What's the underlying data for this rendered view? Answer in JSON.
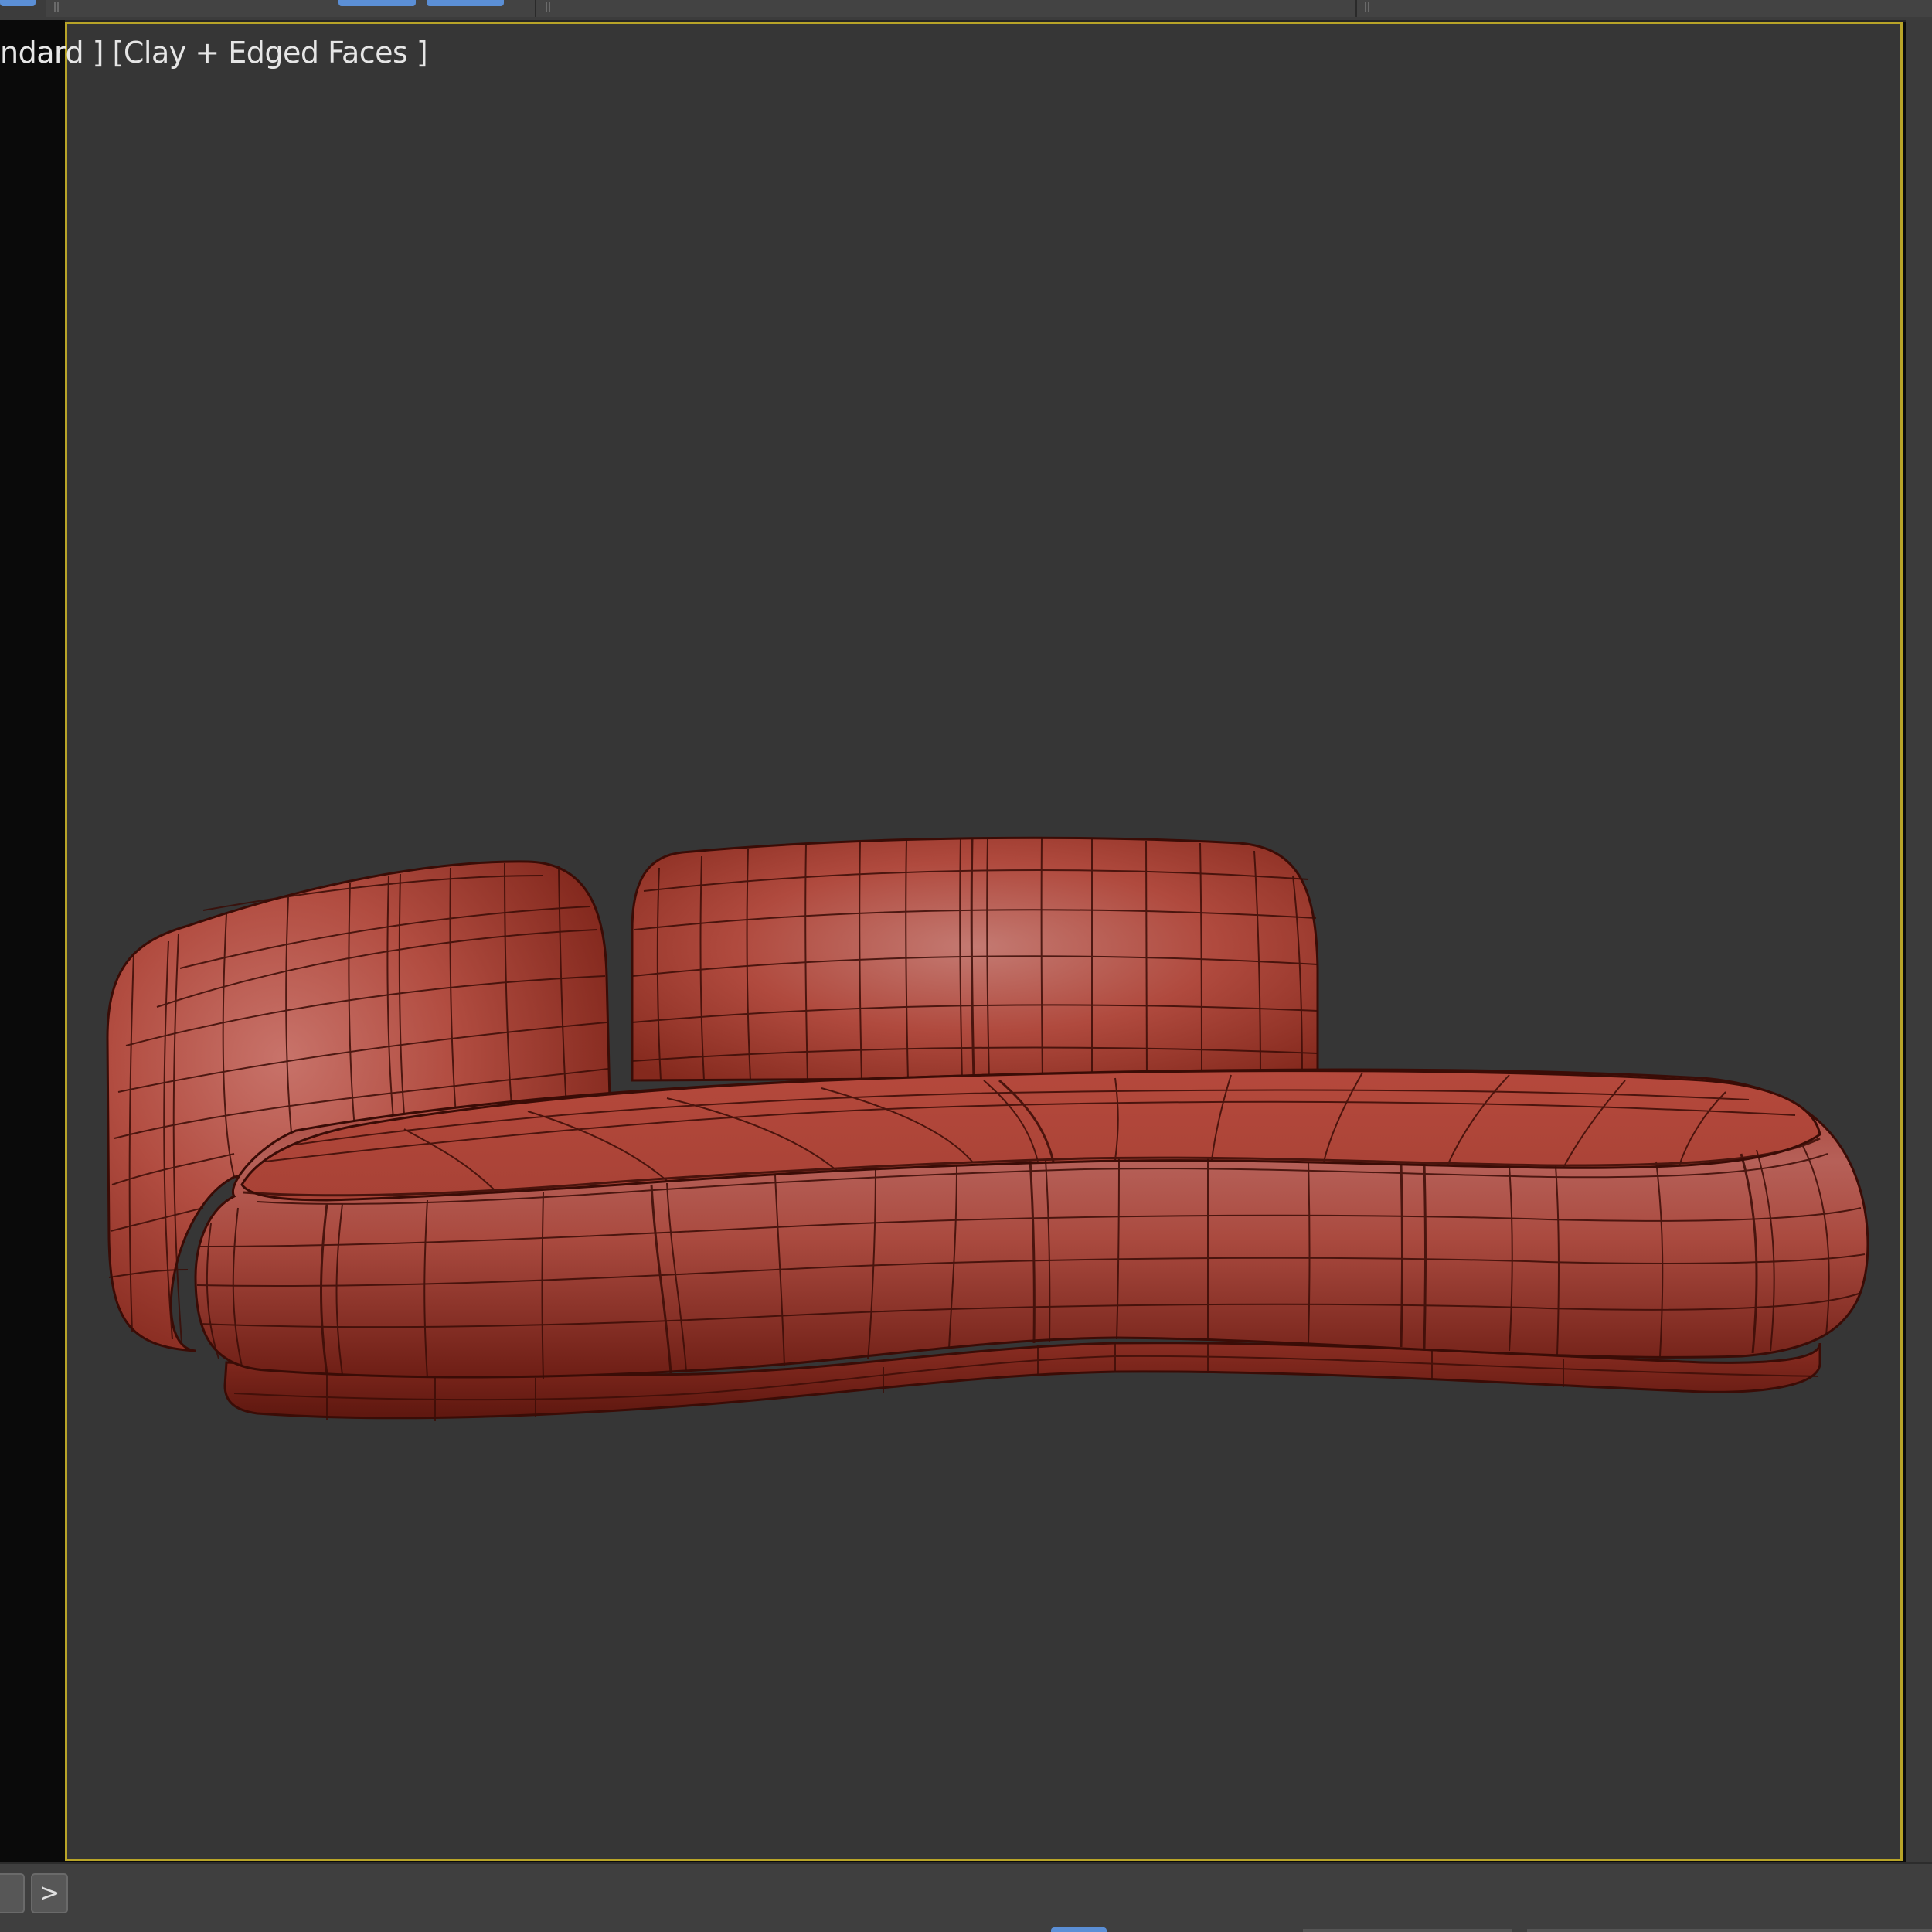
{
  "viewport": {
    "label": "ndard ] [Clay + Edged Faces ]",
    "shading_mode": "Clay + Edged Faces",
    "active_border_color": "#b8a428",
    "background_color": "#363636"
  },
  "model": {
    "description_icon": "sofa-icon",
    "material_color": "#b8463a"
  },
  "bottombar": {
    "next_label": ">"
  }
}
